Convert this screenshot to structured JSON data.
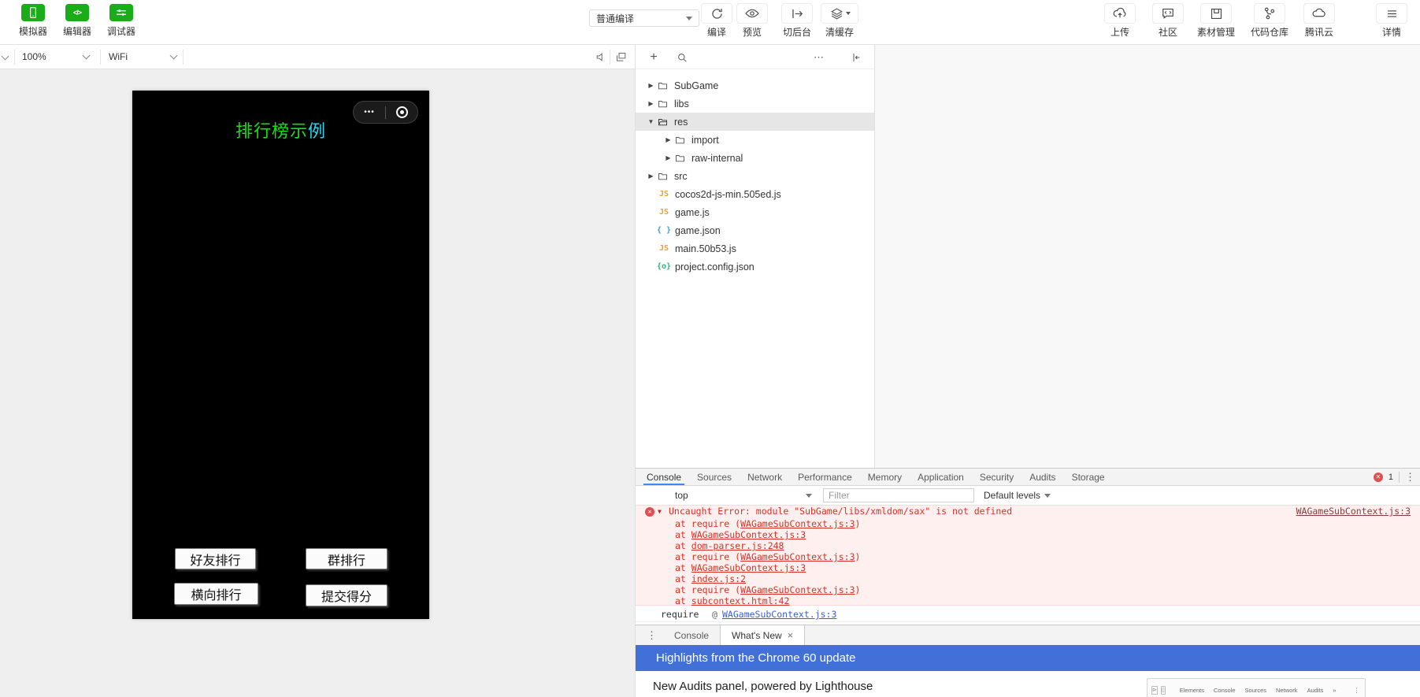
{
  "toolbar": {
    "simulator": "模拟器",
    "editor": "编辑器",
    "debugger": "调试器",
    "compile_mode": "普通编译",
    "compile": "编译",
    "preview": "预览",
    "switch_background": "切后台",
    "clear_cache": "清缓存",
    "upload": "上传",
    "community": "社区",
    "assets": "素材管理",
    "repository": "代码仓库",
    "tencent_cloud": "腾讯云",
    "details": "详情"
  },
  "simulator_bar": {
    "zoom": "100%",
    "network": "WiFi"
  },
  "phone": {
    "title_green": "排行榜示",
    "title_cyan": "例",
    "capsule_more": "•••",
    "btn_friend": "好友排行",
    "btn_group": "群排行",
    "btn_horizontal": "横向排行",
    "btn_submit": "提交得分"
  },
  "file_tree": {
    "items": [
      {
        "name": "SubGame",
        "type": "folder",
        "arrow": "▶",
        "depth": 0
      },
      {
        "name": "libs",
        "type": "folder",
        "arrow": "▶",
        "depth": 0
      },
      {
        "name": "res",
        "type": "folder",
        "arrow": "▼",
        "depth": 0,
        "selected": true
      },
      {
        "name": "import",
        "type": "folder",
        "arrow": "▶",
        "depth": 1
      },
      {
        "name": "raw-internal",
        "type": "folder",
        "arrow": "▶",
        "depth": 1
      },
      {
        "name": "src",
        "type": "folder",
        "arrow": "▶",
        "depth": 0
      },
      {
        "name": "cocos2d-js-min.505ed.js",
        "type": "js",
        "badge": "JS"
      },
      {
        "name": "game.js",
        "type": "js",
        "badge": "JS"
      },
      {
        "name": "game.json",
        "type": "json",
        "badge": "{ }"
      },
      {
        "name": "main.50b53.js",
        "type": "js",
        "badge": "JS"
      },
      {
        "name": "project.config.json",
        "type": "config",
        "badge": "{o}"
      }
    ]
  },
  "devtools": {
    "tabs": [
      "Console",
      "Sources",
      "Network",
      "Performance",
      "Memory",
      "Application",
      "Security",
      "Audits",
      "Storage"
    ],
    "active_tab": "Console",
    "error_count": "1",
    "context": "top",
    "filter_placeholder": "Filter",
    "levels": "Default levels",
    "error": {
      "message": "Uncaught Error: module \"SubGame/libs/xmldom/sax\" is not defined",
      "source_link": "WAGameSubContext.js:3",
      "stack": [
        {
          "pre": "at require (",
          "link": "WAGameSubContext.js:3",
          "suf": ")"
        },
        {
          "pre": "at ",
          "link": "WAGameSubContext.js:3",
          "suf": ""
        },
        {
          "pre": "at ",
          "link": "dom-parser.js:248",
          "suf": ""
        },
        {
          "pre": "at require (",
          "link": "WAGameSubContext.js:3",
          "suf": ")"
        },
        {
          "pre": "at ",
          "link": "WAGameSubContext.js:3",
          "suf": ""
        },
        {
          "pre": "at ",
          "link": "index.js:2",
          "suf": ""
        },
        {
          "pre": "at require (",
          "link": "WAGameSubContext.js:3",
          "suf": ")"
        },
        {
          "pre": "at ",
          "link": "subcontext.html:42",
          "suf": ""
        }
      ],
      "footer_label": "require",
      "footer_at": "@",
      "footer_link": "WAGameSubContext.js:3"
    }
  },
  "drawer": {
    "console_tab": "Console",
    "whats_new_tab": "What's New",
    "banner": "Highlights from the Chrome 60 update",
    "content_heading": "New Audits panel, powered by Lighthouse",
    "mini_tabs": [
      "Elements",
      "Console",
      "Sources",
      "Network",
      "Audits",
      "»"
    ]
  },
  "icons": {
    "kebab": "⋮",
    "more": "⋯",
    "plus": "+",
    "close": "×",
    "expand": "▼",
    "error_x": "✕"
  },
  "colors": {
    "wechat_green": "#1aad19",
    "tab_accent_blue": "#4285f4",
    "error_red": "#d93025",
    "error_bg": "#fff0f0",
    "banner_blue": "#4170d8",
    "title_green": "#16e016",
    "title_cyan": "#29d8ef",
    "footer_link_blue": "#3a5fcd"
  }
}
